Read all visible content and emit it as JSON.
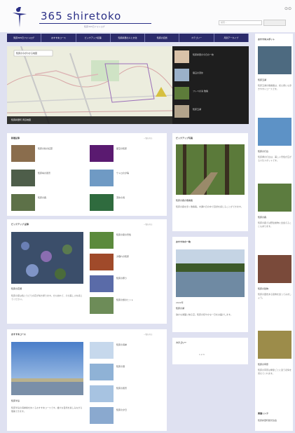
{
  "header": {
    "title": "365 shiretoko",
    "subtitle": "知床365日フォトログ",
    "search_placeholder": "検索...",
    "icons": "⊙⊙"
  },
  "nav": [
    "知床365日フォトログ",
    "おすすめコース",
    "ピックアップ記事",
    "知床斜里の人と文化",
    "知床の自然",
    "カテゴリー",
    "月別アーカイブ"
  ],
  "map": {
    "badge": "知床の今がわかる地図",
    "caption": "知床斜里町 周辺地図",
    "side": [
      "知床斜里の今日の一枚",
      "羅臼の流氷",
      "フレペの滝 散策",
      "知床五湖"
    ]
  },
  "recent": {
    "title": "新着記事",
    "more": "一覧を見る",
    "items": [
      "知床の秋の紅葉",
      "星空の知床",
      "知床峠の風景",
      "ウトロの夕陽",
      "知床の森",
      "流氷の海"
    ]
  },
  "pickup": {
    "title": "ピックアップ 記事",
    "more": "一覧を見る",
    "main_title": "知床の花畑",
    "main_text": "知床の夏は色とりどりの花が咲き誇ります。ぜひ訪れて、その美しさを感じてください。",
    "items": [
      "知床の夏の景色",
      "夕暮れの知床",
      "知床の祭り",
      "知床の旅のヒント"
    ]
  },
  "course": {
    "title": "おすすめコース",
    "more": "一覧を見る",
    "main_title": "知床半島",
    "main_text": "知床半島の海岸線をめぐるおすすめコースです。雄大な自然を楽しみながら散策できます。",
    "items": [
      "知床の海岸",
      "知床の港",
      "知床の風景",
      "知床の夕日"
    ]
  },
  "mid1": {
    "title": "ピックアップ写真",
    "cap": "知床の森の散策路",
    "text": "知床の森を歩く散策路。木漏れ日の中で自然を感じることができます。"
  },
  "mid2": {
    "title": "おすすめの一枚",
    "date": "2022年",
    "cap": "知床の湖",
    "text": "静かな湖面に映る空。知床の穏やかな一日をお届けします。"
  },
  "mid3": {
    "title": "カテゴリー",
    "pages": "1 2 3"
  },
  "side": {
    "title": "おすすめスポット",
    "items": [
      {
        "t": "知床五湖",
        "d": "知床五湖の散策路は、初心者にも歩きやすいコースです。"
      },
      {
        "t": "知床の灯台",
        "d": "知床岬の灯台は、美しい景色が広がる人気スポットです。"
      },
      {
        "t": "知床の森",
        "d": "知床の森では野生動物に出会えることもあります。"
      },
      {
        "t": "知床の建物",
        "d": "知床の歴史ある建物を巡ってみましょう。"
      },
      {
        "t": "知床の草原",
        "d": "知床の草原は季節ごとに違う表情を見せてくれます。"
      }
    ],
    "footer": "関連リンク",
    "footer2": "知床斜里町観光協会"
  }
}
